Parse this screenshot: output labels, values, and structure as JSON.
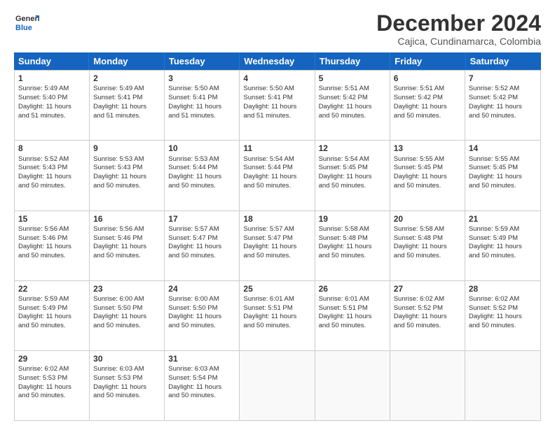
{
  "logo": {
    "line1": "General",
    "line2": "Blue"
  },
  "title": "December 2024",
  "location": "Cajica, Cundinamarca, Colombia",
  "days_of_week": [
    "Sunday",
    "Monday",
    "Tuesday",
    "Wednesday",
    "Thursday",
    "Friday",
    "Saturday"
  ],
  "weeks": [
    [
      {
        "day": "1",
        "lines": [
          "Sunrise: 5:49 AM",
          "Sunset: 5:40 PM",
          "Daylight: 11 hours",
          "and 51 minutes."
        ]
      },
      {
        "day": "2",
        "lines": [
          "Sunrise: 5:49 AM",
          "Sunset: 5:41 PM",
          "Daylight: 11 hours",
          "and 51 minutes."
        ]
      },
      {
        "day": "3",
        "lines": [
          "Sunrise: 5:50 AM",
          "Sunset: 5:41 PM",
          "Daylight: 11 hours",
          "and 51 minutes."
        ]
      },
      {
        "day": "4",
        "lines": [
          "Sunrise: 5:50 AM",
          "Sunset: 5:41 PM",
          "Daylight: 11 hours",
          "and 51 minutes."
        ]
      },
      {
        "day": "5",
        "lines": [
          "Sunrise: 5:51 AM",
          "Sunset: 5:42 PM",
          "Daylight: 11 hours",
          "and 50 minutes."
        ]
      },
      {
        "day": "6",
        "lines": [
          "Sunrise: 5:51 AM",
          "Sunset: 5:42 PM",
          "Daylight: 11 hours",
          "and 50 minutes."
        ]
      },
      {
        "day": "7",
        "lines": [
          "Sunrise: 5:52 AM",
          "Sunset: 5:42 PM",
          "Daylight: 11 hours",
          "and 50 minutes."
        ]
      }
    ],
    [
      {
        "day": "8",
        "lines": [
          "Sunrise: 5:52 AM",
          "Sunset: 5:43 PM",
          "Daylight: 11 hours",
          "and 50 minutes."
        ]
      },
      {
        "day": "9",
        "lines": [
          "Sunrise: 5:53 AM",
          "Sunset: 5:43 PM",
          "Daylight: 11 hours",
          "and 50 minutes."
        ]
      },
      {
        "day": "10",
        "lines": [
          "Sunrise: 5:53 AM",
          "Sunset: 5:44 PM",
          "Daylight: 11 hours",
          "and 50 minutes."
        ]
      },
      {
        "day": "11",
        "lines": [
          "Sunrise: 5:54 AM",
          "Sunset: 5:44 PM",
          "Daylight: 11 hours",
          "and 50 minutes."
        ]
      },
      {
        "day": "12",
        "lines": [
          "Sunrise: 5:54 AM",
          "Sunset: 5:45 PM",
          "Daylight: 11 hours",
          "and 50 minutes."
        ]
      },
      {
        "day": "13",
        "lines": [
          "Sunrise: 5:55 AM",
          "Sunset: 5:45 PM",
          "Daylight: 11 hours",
          "and 50 minutes."
        ]
      },
      {
        "day": "14",
        "lines": [
          "Sunrise: 5:55 AM",
          "Sunset: 5:45 PM",
          "Daylight: 11 hours",
          "and 50 minutes."
        ]
      }
    ],
    [
      {
        "day": "15",
        "lines": [
          "Sunrise: 5:56 AM",
          "Sunset: 5:46 PM",
          "Daylight: 11 hours",
          "and 50 minutes."
        ]
      },
      {
        "day": "16",
        "lines": [
          "Sunrise: 5:56 AM",
          "Sunset: 5:46 PM",
          "Daylight: 11 hours",
          "and 50 minutes."
        ]
      },
      {
        "day": "17",
        "lines": [
          "Sunrise: 5:57 AM",
          "Sunset: 5:47 PM",
          "Daylight: 11 hours",
          "and 50 minutes."
        ]
      },
      {
        "day": "18",
        "lines": [
          "Sunrise: 5:57 AM",
          "Sunset: 5:47 PM",
          "Daylight: 11 hours",
          "and 50 minutes."
        ]
      },
      {
        "day": "19",
        "lines": [
          "Sunrise: 5:58 AM",
          "Sunset: 5:48 PM",
          "Daylight: 11 hours",
          "and 50 minutes."
        ]
      },
      {
        "day": "20",
        "lines": [
          "Sunrise: 5:58 AM",
          "Sunset: 5:48 PM",
          "Daylight: 11 hours",
          "and 50 minutes."
        ]
      },
      {
        "day": "21",
        "lines": [
          "Sunrise: 5:59 AM",
          "Sunset: 5:49 PM",
          "Daylight: 11 hours",
          "and 50 minutes."
        ]
      }
    ],
    [
      {
        "day": "22",
        "lines": [
          "Sunrise: 5:59 AM",
          "Sunset: 5:49 PM",
          "Daylight: 11 hours",
          "and 50 minutes."
        ]
      },
      {
        "day": "23",
        "lines": [
          "Sunrise: 6:00 AM",
          "Sunset: 5:50 PM",
          "Daylight: 11 hours",
          "and 50 minutes."
        ]
      },
      {
        "day": "24",
        "lines": [
          "Sunrise: 6:00 AM",
          "Sunset: 5:50 PM",
          "Daylight: 11 hours",
          "and 50 minutes."
        ]
      },
      {
        "day": "25",
        "lines": [
          "Sunrise: 6:01 AM",
          "Sunset: 5:51 PM",
          "Daylight: 11 hours",
          "and 50 minutes."
        ]
      },
      {
        "day": "26",
        "lines": [
          "Sunrise: 6:01 AM",
          "Sunset: 5:51 PM",
          "Daylight: 11 hours",
          "and 50 minutes."
        ]
      },
      {
        "day": "27",
        "lines": [
          "Sunrise: 6:02 AM",
          "Sunset: 5:52 PM",
          "Daylight: 11 hours",
          "and 50 minutes."
        ]
      },
      {
        "day": "28",
        "lines": [
          "Sunrise: 6:02 AM",
          "Sunset: 5:52 PM",
          "Daylight: 11 hours",
          "and 50 minutes."
        ]
      }
    ],
    [
      {
        "day": "29",
        "lines": [
          "Sunrise: 6:02 AM",
          "Sunset: 5:53 PM",
          "Daylight: 11 hours",
          "and 50 minutes."
        ]
      },
      {
        "day": "30",
        "lines": [
          "Sunrise: 6:03 AM",
          "Sunset: 5:53 PM",
          "Daylight: 11 hours",
          "and 50 minutes."
        ]
      },
      {
        "day": "31",
        "lines": [
          "Sunrise: 6:03 AM",
          "Sunset: 5:54 PM",
          "Daylight: 11 hours",
          "and 50 minutes."
        ]
      },
      {
        "day": "",
        "lines": []
      },
      {
        "day": "",
        "lines": []
      },
      {
        "day": "",
        "lines": []
      },
      {
        "day": "",
        "lines": []
      }
    ]
  ]
}
